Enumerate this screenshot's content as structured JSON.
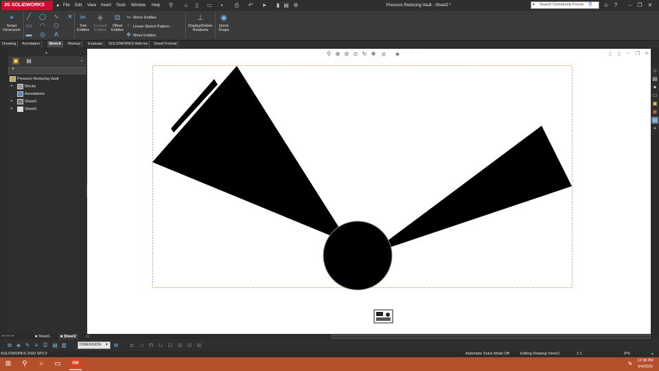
{
  "app": {
    "logo": "SOLIDWORKS",
    "logo_prefix": "3S",
    "title": "Pressure Reducing Vault - Sheet2 *",
    "menu": [
      "File",
      "Edit",
      "View",
      "Insert",
      "Tools",
      "Window",
      "Help"
    ],
    "search_placeholder": "Search Community Forum"
  },
  "ribbon": {
    "smart_dimension": "Smart Dimension",
    "trim_entities": "Trim Entities",
    "convert_entities": "Convert Entities",
    "offset_entities": "Offset Entities",
    "mirror_entities": "Mirror Entities",
    "linear_sketch_pattern": "Linear Sketch Pattern",
    "move_entities": "Move Entities",
    "display_delete_relations": "Display/Delete Relations",
    "quick_snaps": "Quick Snaps"
  },
  "command_tabs": [
    "Drawing",
    "Annotation",
    "Sketch",
    "Markup",
    "Evaluate",
    "SOLIDWORKS Add-Ins",
    "Sheet Format"
  ],
  "active_command_tab": "Sketch",
  "feature_tree": {
    "root": "Pressure Reducing Vault",
    "items": [
      "Blocks",
      "Annotations",
      "Sheet1",
      "Sheet2"
    ]
  },
  "sheet_tabs": [
    "Sheet1",
    "Sheet2"
  ],
  "active_sheet": "Sheet2",
  "bottom_toolbar": {
    "layer": "DIMENSION"
  },
  "status": {
    "version": "SOLIDWORKS 2020 SP2.0",
    "solve_mode": "Automatic Solve Mode Off",
    "editing": "Editing Drawing View11",
    "scale": "1:1",
    "units": "IPS"
  },
  "clock": {
    "time": "12:38 PM",
    "date": "6/4/2020"
  }
}
